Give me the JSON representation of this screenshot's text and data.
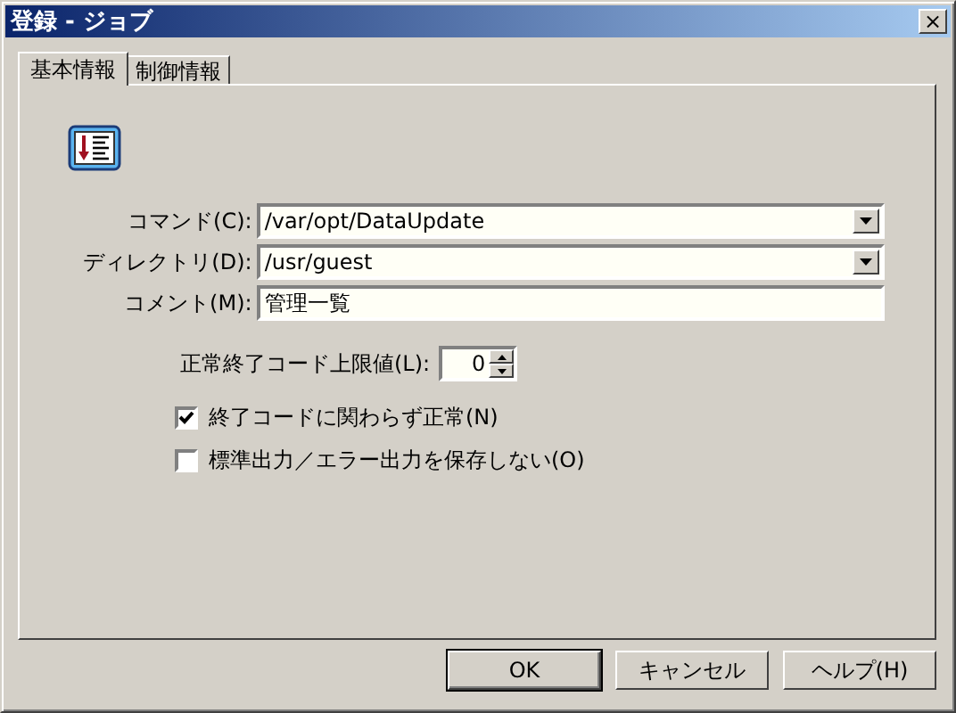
{
  "window": {
    "title": "登録 - ジョブ",
    "close": "×"
  },
  "tabs": [
    {
      "label": "基本情報",
      "selected": true
    },
    {
      "label": "制御情報",
      "selected": false
    }
  ],
  "fields": [
    {
      "kind": "combo",
      "label": "コマンド(C):",
      "value": "/var/opt/DataUpdate"
    },
    {
      "kind": "combo",
      "label": "ディレクトリ(D):",
      "value": "/usr/guest"
    },
    {
      "kind": "text",
      "label": "コメント(M):",
      "value": "管理一覧"
    }
  ],
  "spin": {
    "label": "正常終了コード上限値(L):",
    "value": "0"
  },
  "checkboxes": [
    {
      "label": "終了コードに関わらず正常(N)",
      "checked": true
    },
    {
      "label": "標準出力／エラー出力を保存しない(O)",
      "checked": false
    }
  ],
  "buttons": [
    {
      "label": "OK",
      "default": true
    },
    {
      "label": "キャンセル",
      "default": false
    },
    {
      "label": "ヘルプ(H)",
      "default": false
    }
  ]
}
